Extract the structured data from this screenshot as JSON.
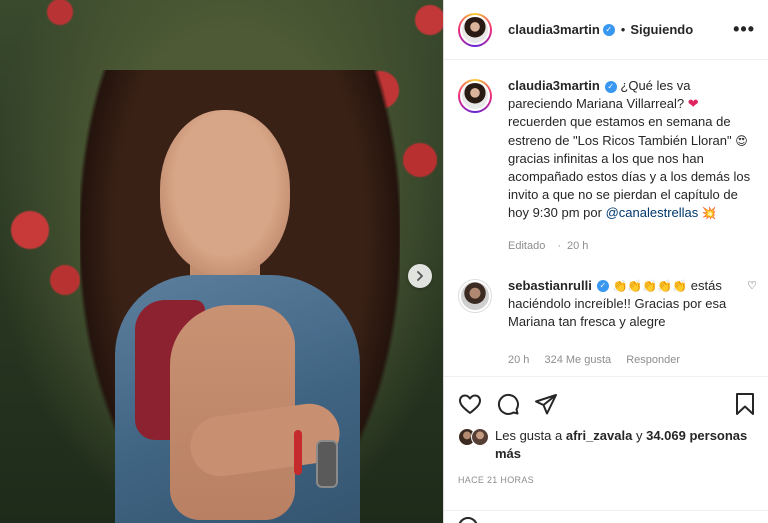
{
  "post": {
    "image_alt": "Mujer sonriente con chaleco de mezclilla",
    "next_icon": "chevron-right-icon"
  },
  "header": {
    "username": "claudia3martin",
    "separator": "•",
    "follow_status": "Siguiendo",
    "more_label": "•••"
  },
  "caption": {
    "username": "claudia3martin",
    "text_1": "¿Qué les va pareciendo Mariana Villarreal?",
    "heart": "❤",
    "text_2": "recuerden que estamos en semana de estreno de \"Los Ricos También Lloran\"",
    "emoji_1": "😍",
    "text_3": "gracias infinitas a los que nos han acompañado estos días y a los demás los invito a que no se pierdan el capítulo de hoy 9:30 pm por",
    "mention": "@canalestrellas",
    "emoji_2": "💥",
    "edited": "Editado",
    "time": "20 h"
  },
  "comment": {
    "username": "sebastianrulli",
    "emojis": "👏👏👏👏👏",
    "text": "estás haciéndolo increíble!! Gracias por esa Mariana tan fresca y alegre",
    "time": "20 h",
    "likes": "324 Me gusta",
    "reply": "Responder",
    "like_icon": "♡"
  },
  "actions": {
    "like_icon": "heart-icon",
    "comment_icon": "comment-icon",
    "share_icon": "share-icon",
    "save_icon": "bookmark-icon"
  },
  "likes": {
    "prefix": "Les gusta a",
    "user": "afri_zavala",
    "connector": "y",
    "count": "34.069 personas más"
  },
  "timestamp": "HACE 21 HORAS",
  "colors": {
    "verified": "#3897f0",
    "mention": "#00376b",
    "muted": "#8e8e8e",
    "text": "#262626"
  }
}
